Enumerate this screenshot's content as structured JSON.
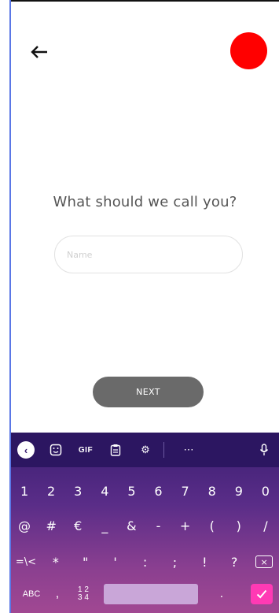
{
  "header": {
    "back_icon": "back-arrow-icon",
    "avatar_color": "#ff0000"
  },
  "main": {
    "title": "What should we call you?",
    "name_placeholder": "Name",
    "next_label": "NEXT"
  },
  "keyboard": {
    "toolbar": [
      "collapse-icon",
      "emoji-icon",
      "GIF",
      "clipboard-icon",
      "settings-icon",
      "more-icon",
      "mic-icon"
    ],
    "row1": [
      "1",
      "2",
      "3",
      "4",
      "5",
      "6",
      "7",
      "8",
      "9",
      "0"
    ],
    "row2": [
      "@",
      "#",
      "€",
      "_",
      "&",
      "-",
      "+",
      "(",
      ")",
      "/"
    ],
    "row3": [
      "=\\<",
      "*",
      "\"",
      "'",
      ":",
      ";",
      "!",
      "?"
    ],
    "row4": {
      "abc": "ABC",
      "comma": ",",
      "num_top": "1 2",
      "num_bottom": "3 4",
      "period": "."
    },
    "colors": {
      "top": "#3a1e72",
      "bottom": "#a14892",
      "enter": "#ff3ab4",
      "space": "#c9a6d8"
    }
  }
}
